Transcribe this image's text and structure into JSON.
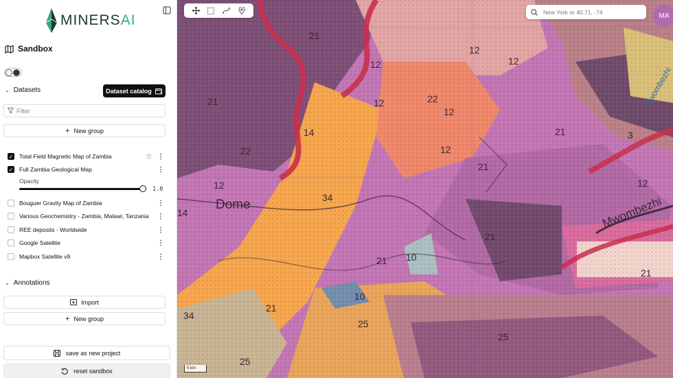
{
  "app": {
    "logo_text_main": "MINERS",
    "logo_text_accent": "AI",
    "title": "Sandbox"
  },
  "datasets": {
    "heading": "Datasets",
    "catalog_button": "Dataset catalog",
    "filter_placeholder": "Filter",
    "new_group_label": "New group",
    "layers": [
      {
        "label": "Total Field Magnetic Map of Zambia",
        "checked": true
      },
      {
        "label": "Full Zambia Geological Map",
        "checked": true
      },
      {
        "label": "Bouguer Gravity Map of Zambia",
        "checked": false
      },
      {
        "label": "Various Geochemistry - Zambia, Malawi, Tanzania",
        "checked": false
      },
      {
        "label": "REE deposits - Worldwide",
        "checked": false
      },
      {
        "label": "Google Satellite",
        "checked": false
      },
      {
        "label": "Mapbox Satellite v9",
        "checked": false
      }
    ],
    "opacity_label": "Opacity",
    "opacity_value": "1.0",
    "opacity_fraction": 1.0
  },
  "annotations": {
    "heading": "Annotations",
    "import_label": "Import",
    "new_group_label": "New group"
  },
  "footer": {
    "save_label": "save as new project",
    "reset_label": "reset sandbox"
  },
  "map": {
    "search_placeholder": "New York or 40.71, -74",
    "avatar_initials": "MA",
    "scale_label": "5 km",
    "labels": [
      "21",
      "12",
      "12",
      "12",
      "12",
      "22",
      "12",
      "21",
      "12",
      "21",
      "14",
      "22",
      "12",
      "14",
      "34",
      "Dome",
      "21",
      "21",
      "10",
      "21",
      "10",
      "21",
      "34",
      "25",
      "25",
      "25",
      "3",
      "12",
      "21",
      "Mwombezhi",
      "Mwombezhi"
    ]
  },
  "colors": {
    "accent": "#3aa888",
    "brand_dark": "#1f3a33",
    "avatar": "#b06bb0"
  }
}
